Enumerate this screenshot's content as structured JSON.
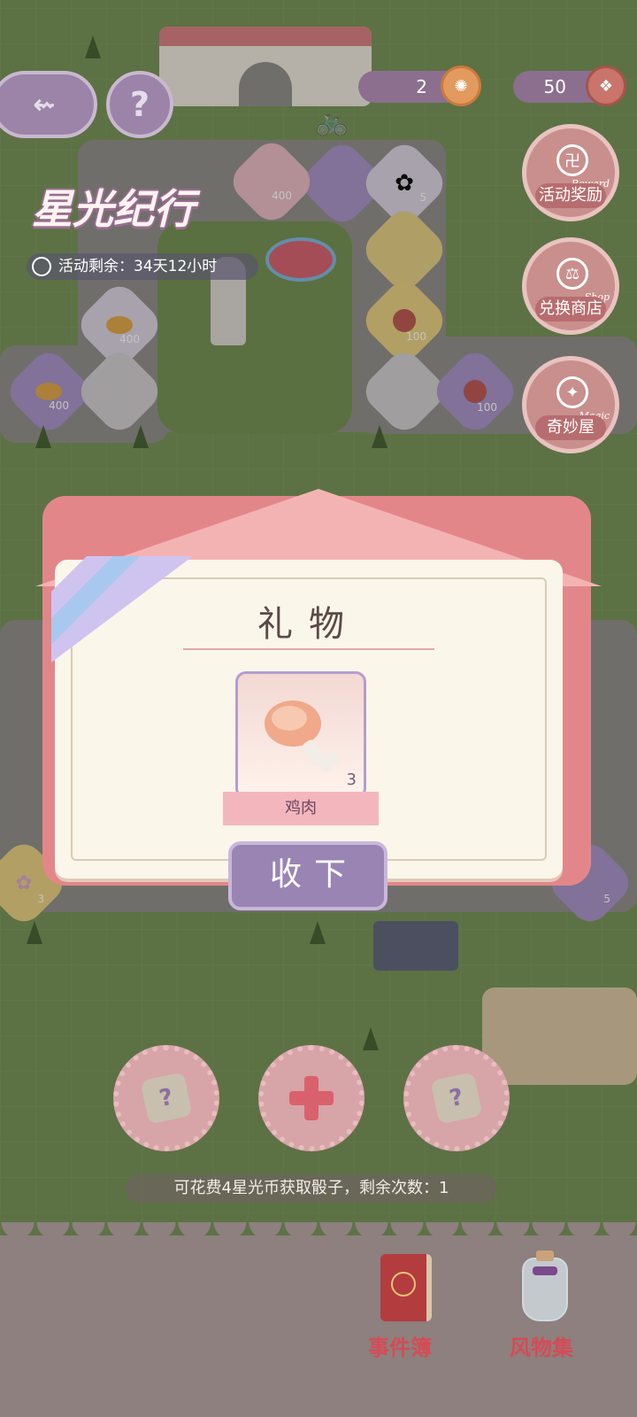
{
  "top_bar": {
    "currency_a_count": "2",
    "currency_b_count": "50"
  },
  "event": {
    "title": "星光纪行",
    "timer_text": "活动剩余：34天12小时"
  },
  "side_menu": [
    {
      "label": "活动奖励",
      "sub": "Reward"
    },
    {
      "label": "兑换商店",
      "sub": "Shop"
    },
    {
      "label": "奇妙屋",
      "sub": "Magic"
    }
  ],
  "board_tiles": {
    "coin_400": "400",
    "flower_5": "5",
    "token_100": "100",
    "flower_3": "3",
    "card_5": "5"
  },
  "popup": {
    "title": "礼物",
    "item_name": "鸡肉",
    "item_count": "3",
    "collect_label": "收下"
  },
  "dice_hint": "可花费4星光币获取骰子，剩余次数：1",
  "bottom_nav": [
    {
      "label": "事件簿"
    },
    {
      "label": "风物集"
    }
  ],
  "colors": {
    "accent_pink": "#e3868a",
    "button_purple": "#9a84b4",
    "bottom_red_text": "#d54b55"
  }
}
